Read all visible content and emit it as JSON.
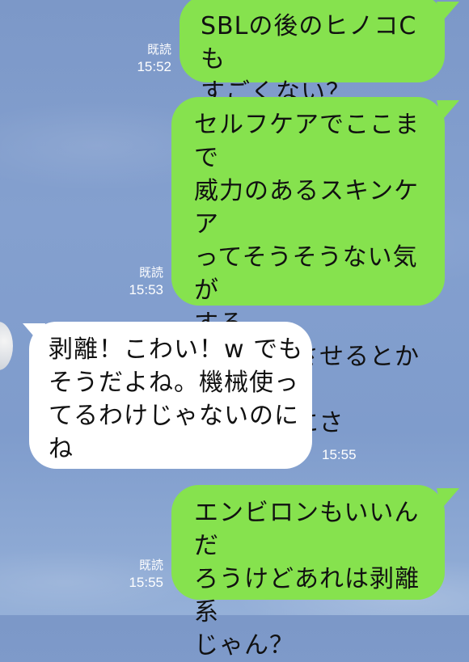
{
  "messages": [
    {
      "direction": "outgoing",
      "text": "SBLの後のヒノコCも\nすごくない？",
      "read_label": "既読",
      "time": "15:52"
    },
    {
      "direction": "outgoing",
      "text": "セルフケアでここまで\n威力のあるスキンケア\nってそうそうない気が\nする。\n一回剥離させるとかじ\nゃないのにさ",
      "read_label": "既読",
      "time": "15:53"
    },
    {
      "direction": "incoming",
      "text": "剥離！こわい！w でも\nそうだよね。機械使っ\nてるわけじゃないのに\nね",
      "time": "15:55"
    },
    {
      "direction": "outgoing",
      "text": "エンビロンもいいんだ\nろうけどあれは剥離系\nじゃん？",
      "read_label": "既読",
      "time": "15:55"
    }
  ],
  "colors": {
    "outgoing_bubble": "#86e24e",
    "incoming_bubble": "#ffffff",
    "background": "#7f9ccc"
  }
}
